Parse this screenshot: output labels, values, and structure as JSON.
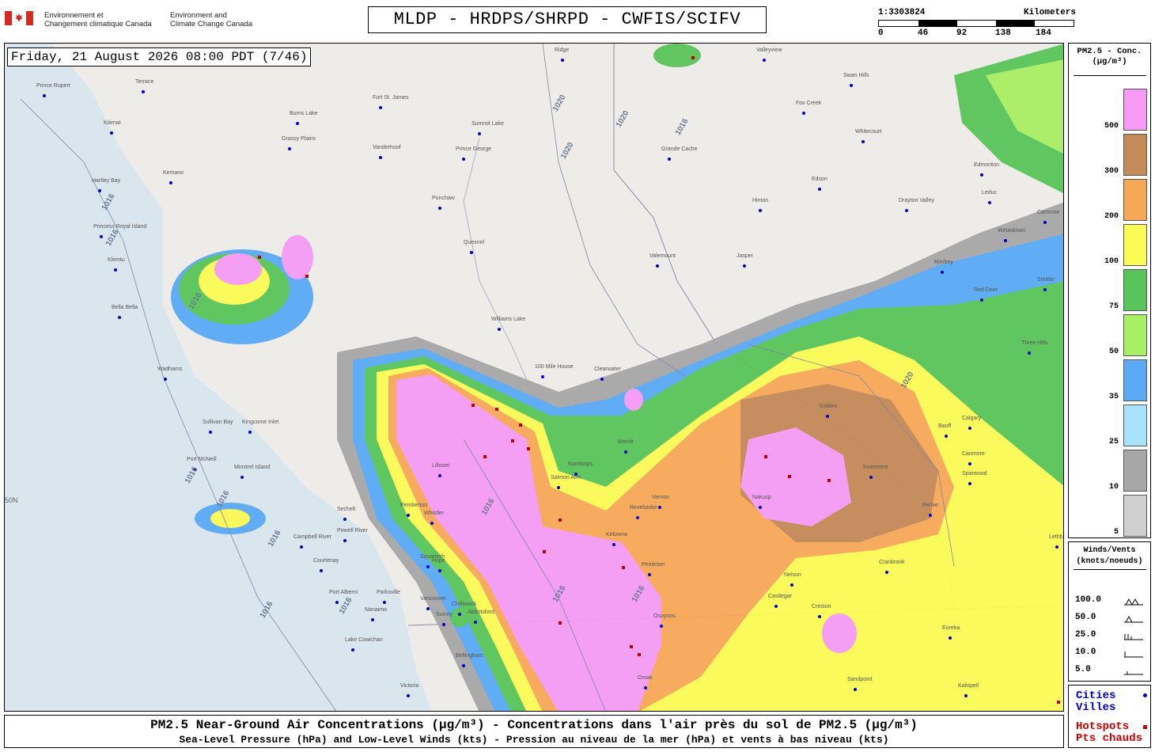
{
  "header": {
    "department_fr": [
      "Environnement et",
      "Changement climatique Canada"
    ],
    "department_en": [
      "Environment and",
      "Climate Change Canada"
    ],
    "title": "MLDP - HRDPS/SHRPD - CWFIS/SCIFV"
  },
  "scale_bar": {
    "ratio": "1:3303824",
    "unit": "Kilometers",
    "ticks": [
      "0",
      "46",
      "92",
      "138",
      "184"
    ]
  },
  "map": {
    "valid_time": "Friday, 21 August 2026 08:00 PDT (7/46)",
    "latitude_label": "50N",
    "isobar_labels": [
      "1020",
      "1020",
      "1020",
      "1016",
      "1016",
      "1016",
      "1016",
      "1016",
      "1016",
      "1016",
      "1016",
      "1016",
      "1016",
      "1016",
      "1016",
      "1020"
    ],
    "places": [
      "Prince Rupert",
      "Terrace",
      "Kitimat",
      "Burns Lake",
      "Fort St. James",
      "Summit Lake",
      "Prince George",
      "Vanderhoof",
      "Grassy Plains",
      "Kemano",
      "Punchaw",
      "Quesnel",
      "Hartley Bay",
      "Princess Royal Island",
      "Klemtu",
      "Bella Bella",
      "Williams Lake",
      "100 Mile House",
      "Wadhams",
      "Sullivan Bay",
      "Kingcome Inlet",
      "Port McNeill",
      "Minstrel Island",
      "Campbell River",
      "Courtenay",
      "Powell River",
      "Squamish",
      "Port Alberni",
      "Parksville",
      "Nanaimo",
      "Vancouver",
      "Surrey",
      "Lake Cowichan",
      "Bellingham",
      "Victoria",
      "Valemount",
      "Jasper",
      "Hinton",
      "Grande Cache",
      "Edson",
      "Whitecourt",
      "Fox Creek",
      "Swan Hills",
      "Edmonton",
      "Leduc",
      "Drayton Valley",
      "Wetaskiwin",
      "Camrose",
      "Rimbey",
      "Red Deer",
      "Stettler",
      "Three Hills",
      "Clearwater",
      "Kamloops",
      "Salmon Arm",
      "Revelstoke",
      "Golden",
      "Banff",
      "Calgary",
      "Canmore",
      "Invermere",
      "Nakusp",
      "Vernon",
      "Kelowna",
      "Penticton",
      "Osoyoos",
      "Castlegar",
      "Nelson",
      "Cranbrook",
      "Fernie",
      "Sparwood",
      "Lethbridge",
      "Creston",
      "Kalispell",
      "Sandpoint",
      "Omak",
      "Eureka",
      "Ridge",
      "Valleyview",
      "Whistler",
      "Pemberton",
      "Lillooet",
      "Merritt",
      "Hope",
      "Chilliwack",
      "Abbotsford",
      "Sechelt"
    ]
  },
  "legend_concentration": {
    "title_lines": [
      "PM2.5 - Conc.",
      "(µg/m³)"
    ],
    "bins": [
      {
        "label": "500",
        "color": "#f59af5"
      },
      {
        "label": "300",
        "color": "#c48a58"
      },
      {
        "label": "200",
        "color": "#f7a857"
      },
      {
        "label": "100",
        "color": "#fbfb56"
      },
      {
        "label": "75",
        "color": "#58c459"
      },
      {
        "label": "50",
        "color": "#a9ef63"
      },
      {
        "label": "35",
        "color": "#5aaaf6"
      },
      {
        "label": "25",
        "color": "#a8e2fb"
      },
      {
        "label": "10",
        "color": "#a7a7a7"
      },
      {
        "label": "5",
        "color": "#cfcfcf"
      }
    ]
  },
  "legend_wind": {
    "title_lines": [
      "Winds/Vents",
      "(knots/noeuds)"
    ],
    "rows": [
      "100.0",
      "50.0",
      "25.0",
      "10.0",
      "5.0"
    ]
  },
  "legend_points": {
    "cities_lines": [
      "Cities",
      "Villes"
    ],
    "cities_color": "#0000cc",
    "hotspots_lines": [
      "Hotspots",
      "Pts chauds"
    ],
    "hotspots_color": "#cc0000"
  },
  "caption": {
    "line1": "PM2.5 Near-Ground Air Concentrations (µg/m³) - Concentrations dans l'air près du sol de PM2.5 (µg/m³)",
    "line2": "Sea-Level Pressure (hPa) and Low-Level Winds (kts) - Pression au niveau de la mer (hPa) et vents à bas niveau (kts)"
  }
}
